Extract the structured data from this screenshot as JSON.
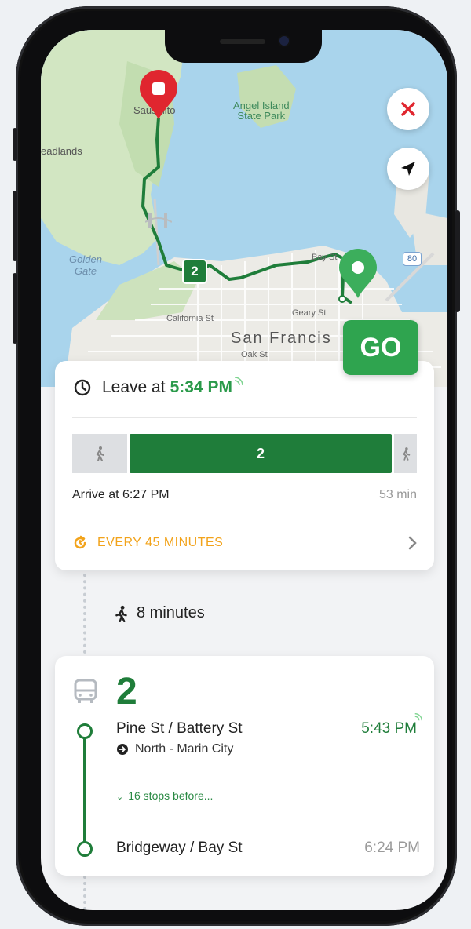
{
  "map": {
    "labels": {
      "sausalito": "Sausalito",
      "angel_island": "Angel Island\nState Park",
      "headlands": "eadlands",
      "golden_gate": "Golden\nGate",
      "california_st": "California St",
      "geary_st": "Geary St",
      "bay_st": "Bay St",
      "oak_st": "Oak St",
      "city": "San Francis",
      "highway": "80"
    },
    "route_badge": "2",
    "go_label": "GO"
  },
  "summary": {
    "leave_prefix": "Leave at",
    "leave_time": "5:34 PM",
    "trip_bar_route": "2",
    "arrive_text": "Arrive at 6:27 PM",
    "duration": "53 min",
    "frequency": "EVERY 45 MINUTES"
  },
  "walk": {
    "text": "8 minutes"
  },
  "route": {
    "number": "2",
    "origin_stop": "Pine St / Battery St",
    "origin_time": "5:43 PM",
    "direction": "North - Marin City",
    "stops_before": "16 stops before...",
    "dest_stop": "Bridgeway / Bay St",
    "dest_time": "6:24 PM"
  },
  "colors": {
    "brand_green": "#1f7d3a",
    "realtime_green": "#2a9a4a",
    "go_green": "#2fa44f",
    "warning_orange": "#f2a31b",
    "close_red": "#e0262f"
  }
}
